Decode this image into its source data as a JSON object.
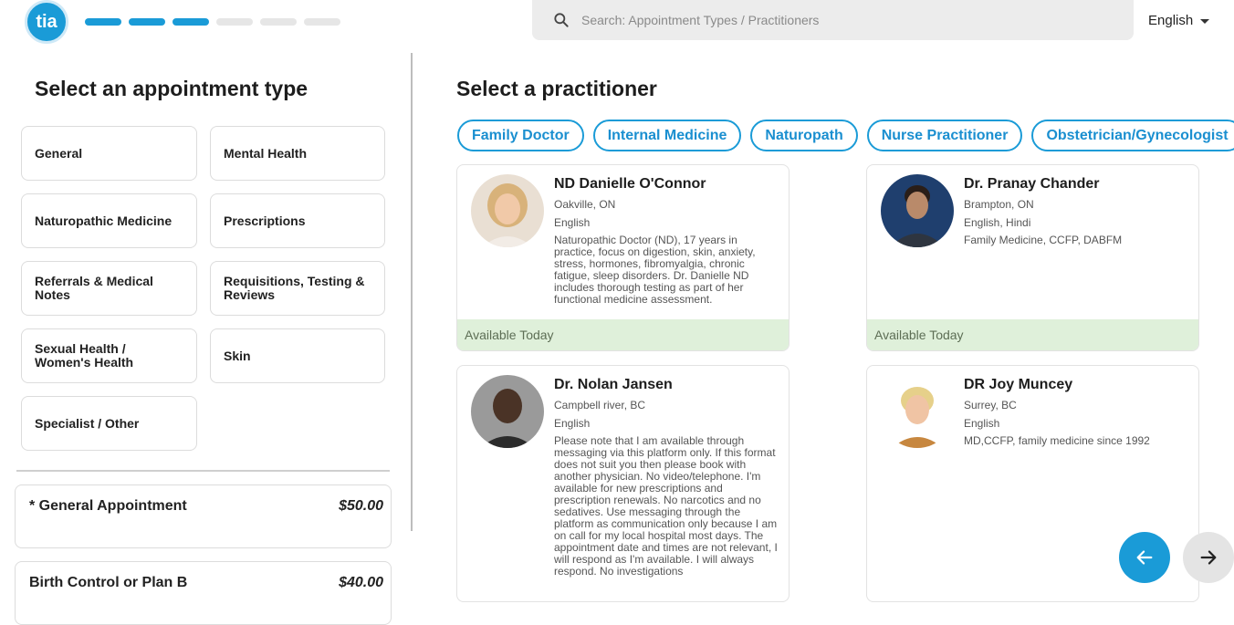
{
  "header": {
    "logo_text": "tia",
    "progress": {
      "completed_steps": 3,
      "total_steps": 6
    },
    "search_placeholder": "Search: Appointment Types / Practitioners",
    "language": "English"
  },
  "left": {
    "title": "Select an appointment type",
    "types": [
      "General",
      "Mental Health",
      "Naturopathic Medicine",
      "Prescriptions",
      "Referrals & Medical Notes",
      "Requisitions, Testing & Reviews",
      "Sexual Health / Women's Health",
      "Skin",
      "Specialist / Other"
    ],
    "appointments": [
      {
        "name": "* General Appointment",
        "price": "$50.00"
      },
      {
        "name": "Birth Control or Plan B",
        "price": "$40.00"
      }
    ]
  },
  "right": {
    "title": "Select a practitioner",
    "filters": [
      "Family Doctor",
      "Internal Medicine",
      "Naturopath",
      "Nurse Practitioner",
      "Obstetrician/Gynecologist"
    ],
    "practitioners": [
      {
        "name": "ND Danielle O'Connor",
        "location": "Oakville, ON",
        "languages": "English",
        "bio": "Naturopathic Doctor (ND), 17 years in practice, focus on digestion, skin, anxiety, stress, hormones, fibromyalgia, chronic fatigue, sleep disorders. Dr. Danielle ND includes thorough testing as part of her functional medicine assessment.",
        "availability": "Available Today"
      },
      {
        "name": "Dr. Pranay Chander",
        "location": "Brampton, ON",
        "languages": "English, Hindi",
        "bio": "Family Medicine, CCFP, DABFM",
        "availability": "Available Today"
      },
      {
        "name": "Dr. Nolan Jansen",
        "location": "Campbell river, BC",
        "languages": "English",
        "bio": "Please note that I am available through messaging via this platform only. If this format does not suit you then please book with another physician. No video/telephone. I'm available for new prescriptions and prescription renewals. No narcotics and no sedatives. Use messaging through the platform as communication only because I am on call for my local hospital most days. The appointment date and times are not relevant, I will respond as I'm available. I will always respond. No investigations",
        "availability": ""
      },
      {
        "name": "DR Joy Muncey",
        "location": "Surrey, BC",
        "languages": "English",
        "bio": "MD,CCFP, family medicine since 1992",
        "availability": ""
      }
    ]
  },
  "colors": {
    "accent": "#1a9bd7",
    "available_bg": "#dff0da"
  },
  "icons": {
    "search": "search-icon",
    "prev": "arrow-left-icon",
    "next": "arrow-right-icon",
    "language": "chevron-down-icon"
  }
}
